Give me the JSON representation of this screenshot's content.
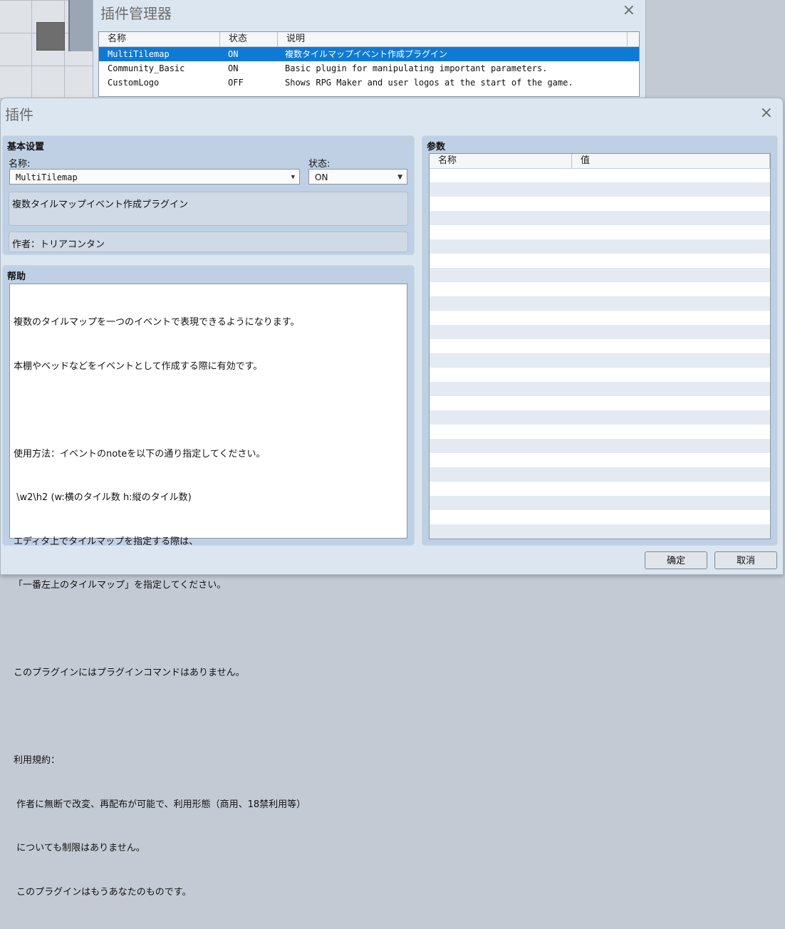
{
  "manager_window": {
    "title": "插件管理器",
    "columns": [
      "名称",
      "状态",
      "说明"
    ],
    "rows": [
      {
        "name": "MultiTilemap",
        "status": "ON",
        "description": "複数タイルマップイベント作成プラグイン",
        "selected": true
      },
      {
        "name": "Community_Basic",
        "status": "ON",
        "description": "Basic plugin for manipulating important parameters."
      },
      {
        "name": "CustomLogo",
        "status": "OFF",
        "description": "Shows RPG Maker and user logos at the start of the game."
      }
    ]
  },
  "plugin_dialog": {
    "title": "插件",
    "basic": {
      "group_label": "基本设置",
      "name_label": "名称:",
      "name_value": "MultiTilemap",
      "status_label": "状态:",
      "status_value": "ON",
      "description": "複数タイルマップイベント作成プラグイン",
      "author": "作者：トリアコンタン"
    },
    "help": {
      "group_label": "帮助",
      "lines": [
        "複数のタイルマップを一つのイベントで表現できるようになります。",
        "本棚やベッドなどをイベントとして作成する際に有効です。",
        "",
        "使用方法：イベントのnoteを以下の通り指定してください。",
        " \\w2\\h2 (w:横のタイル数 h:縦のタイル数)",
        "エディタ上でタイルマップを指定する際は、",
        "「一番左上のタイルマップ」を指定してください。",
        "",
        "このプラグインにはプラグインコマンドはありません。",
        "",
        "利用規約：",
        " 作者に無断で改変、再配布が可能で、利用形態（商用、18禁利用等）",
        " についても制限はありません。",
        " このプラグインはもうあなたのものです。"
      ]
    },
    "params": {
      "group_label": "参数",
      "col_name": "名称",
      "col_value": "值"
    },
    "ok_label": "确定",
    "cancel_label": "取消"
  },
  "icons": {
    "close": "×",
    "dropdown": "▼"
  }
}
